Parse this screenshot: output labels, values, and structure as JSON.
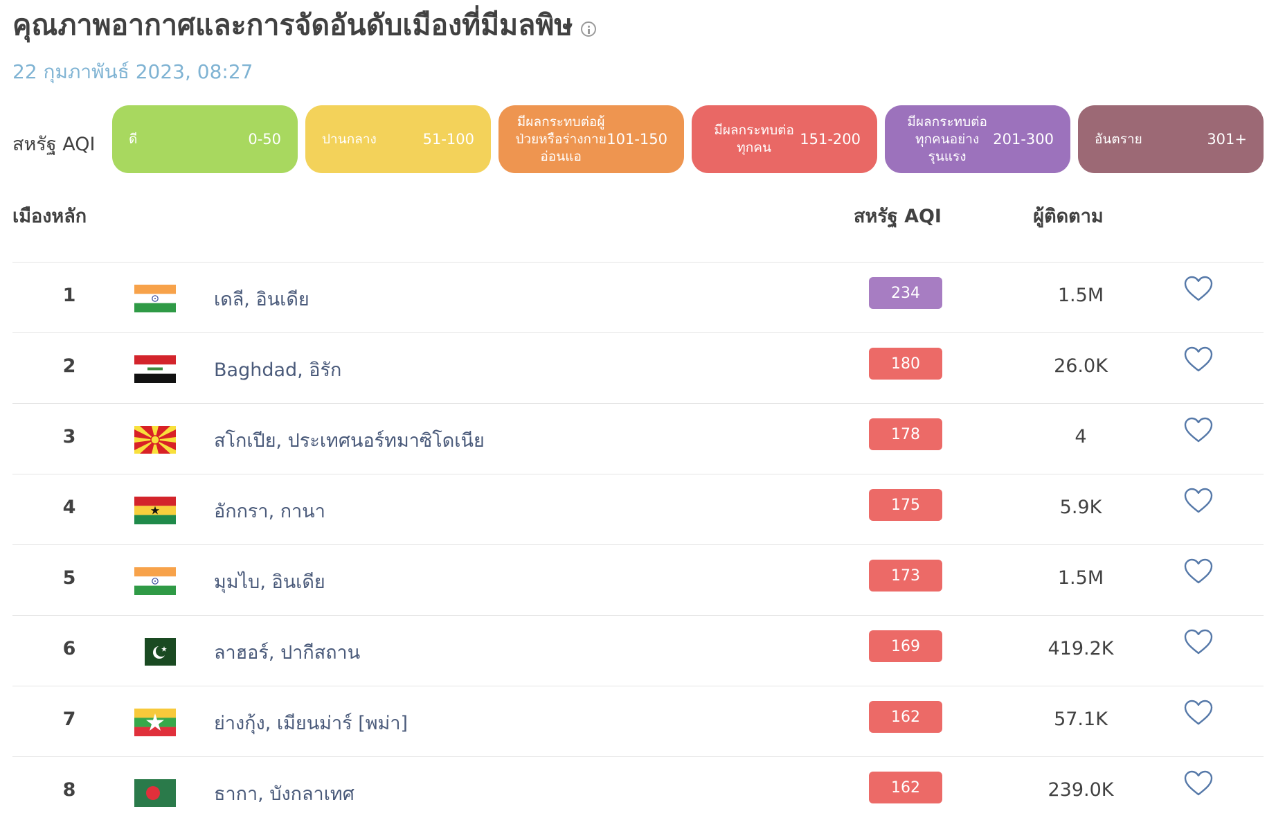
{
  "page": {
    "title": "คุณภาพอากาศและการจัดอันดับเมืองที่มีมลพิษ",
    "date": "22 กุมภาพันธ์ 2023, 08:27"
  },
  "legend": {
    "label": "สหรัฐ AQI",
    "items": [
      {
        "name": "ดี",
        "range": "0-50",
        "color": "#a8d85f"
      },
      {
        "name": "ปานกลาง",
        "range": "51-100",
        "color": "#f3d25a"
      },
      {
        "name": "มีผลกระทบต่อผู้ป่วยหรือร่างกายอ่อนแอ",
        "range": "101-150",
        "color": "#ee9550"
      },
      {
        "name": "มีผลกระทบต่อทุกคน",
        "range": "151-200",
        "color": "#e96865"
      },
      {
        "name": "มีผลกระทบต่อทุกคนอย่างรุนแรง",
        "range": "201-300",
        "color": "#9c72bc"
      },
      {
        "name": "อันตราย",
        "range": "301+",
        "color": "#9c6975"
      }
    ]
  },
  "table": {
    "headers": {
      "city": "เมืองหลัก",
      "aqi": "สหรัฐ AQI",
      "followers": "ผู้ติดตาม"
    },
    "rows": [
      {
        "rank": "1",
        "flag": "india-flag",
        "city": "เดลี, อินเดีย",
        "aqi": "234",
        "aqi_color": "#a77dc2",
        "followers": "1.5M"
      },
      {
        "rank": "2",
        "flag": "iraq-flag",
        "city": "Baghdad, อิรัก",
        "aqi": "180",
        "aqi_color": "#ec6a67",
        "followers": "26.0K"
      },
      {
        "rank": "3",
        "flag": "north-macedonia-flag",
        "city": "สโกเปีย, ประเทศนอร์ทมาซิโดเนีย",
        "aqi": "178",
        "aqi_color": "#ec6a67",
        "followers": "4"
      },
      {
        "rank": "4",
        "flag": "ghana-flag",
        "city": "อักกรา, กานา",
        "aqi": "175",
        "aqi_color": "#ec6a67",
        "followers": "5.9K"
      },
      {
        "rank": "5",
        "flag": "india-flag",
        "city": "มุมไบ, อินเดีย",
        "aqi": "173",
        "aqi_color": "#ec6a67",
        "followers": "1.5M"
      },
      {
        "rank": "6",
        "flag": "pakistan-flag",
        "city": "ลาฮอร์, ปากีสถาน",
        "aqi": "169",
        "aqi_color": "#ec6a67",
        "followers": "419.2K"
      },
      {
        "rank": "7",
        "flag": "myanmar-flag",
        "city": "ย่างกุ้ง, เมียนม่าร์ [พม่า]",
        "aqi": "162",
        "aqi_color": "#ec6a67",
        "followers": "57.1K"
      },
      {
        "rank": "8",
        "flag": "bangladesh-flag",
        "city": "ธากา, บังกลาเทศ",
        "aqi": "162",
        "aqi_color": "#ec6a67",
        "followers": "239.0K"
      }
    ]
  }
}
